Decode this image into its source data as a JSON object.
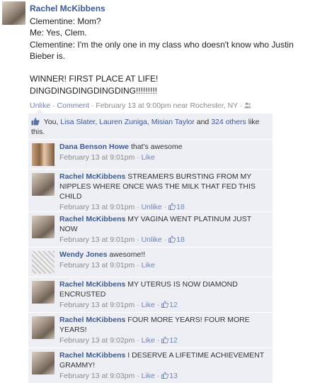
{
  "post": {
    "author": "Rachel McKibbens",
    "lines": [
      "Clementine: Mom?",
      "Me: Yes, Clem.",
      "Clementine: I'm the only one in my class who doesn't know who Justin Bieber is.",
      "",
      "WINNER! FIRST PLACE AT LIFE!",
      "DINGDINGDINGDINGDING!!!!!!!!!"
    ],
    "actions": {
      "unlike": "Unlike",
      "sep": "·",
      "comment": "Comment",
      "timestamp": "February 13 at 9:00pm near Rochester, NY"
    }
  },
  "likes": {
    "you": "You,",
    "names": [
      "Lisa Slater,",
      "Lauren Zuniga,",
      "Misian Taylor"
    ],
    "and": "and",
    "others": "324 others",
    "suffix": "like this."
  },
  "comments": [
    {
      "name": "Dana Benson Howe",
      "text": "that's awesome",
      "time": "February 13 at 9:01pm",
      "action": "Like",
      "likes": ""
    },
    {
      "name": "Rachel McKibbens",
      "text": "STREAMERS BURSTING FROM MY NIPPLES WHERE ONCE WAS THE MILK THAT FED THIS CHILD",
      "time": "February 13 at 9:01pm",
      "action": "Unlike",
      "likes": "18"
    },
    {
      "name": "Rachel McKibbens",
      "text": "MY VAGINA WENT PLATINUM JUST NOW",
      "time": "February 13 at 9:01pm",
      "action": "Unlike",
      "likes": "18"
    },
    {
      "name": "Wendy Jones",
      "text": "awesome!!",
      "time": "February 13 at 9:01pm",
      "action": "Like",
      "likes": ""
    },
    {
      "name": "Rachel McKibbens",
      "text": "MY UTERUS IS NOW DIAMOND ENCRUSTED",
      "time": "February 13 at 9:01pm",
      "action": "Like",
      "likes": "12"
    },
    {
      "name": "Rachel McKibbens",
      "text": "FOUR MORE YEARS! FOUR MORE YEARS!",
      "time": "February 13 at 9:02pm",
      "action": "Like",
      "likes": "12"
    },
    {
      "name": "Rachel McKibbens",
      "text": "I DESERVE A LIFETIME ACHIEVEMENT GRAMMY!",
      "time": "February 13 at 9:03pm",
      "action": "Like",
      "likes": "13"
    }
  ],
  "icons": {
    "people": "audience-friends-icon",
    "thumb": "thumbs-up-icon"
  },
  "colors": {
    "link": "#3b5998",
    "meta": "#8b8b8b",
    "ufi_bg": "#edeff4"
  }
}
